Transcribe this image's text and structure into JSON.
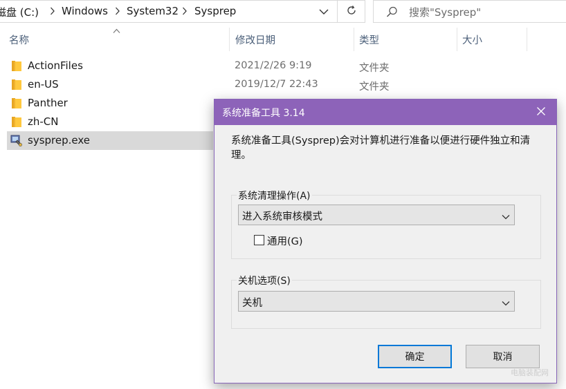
{
  "address": {
    "crumbs": [
      "本地磁盘 (C:)",
      "Windows",
      "System32",
      "Sysprep"
    ],
    "visible_first": "磁盘 (C:)",
    "search_placeholder": "搜索\"Sysprep\""
  },
  "columns": {
    "name": "名称",
    "date": "修改日期",
    "type": "类型",
    "size": "大小"
  },
  "files": [
    {
      "name": "ActionFiles",
      "date": "2021/2/26 9:19",
      "type": "文件夹",
      "icon": "folder-icon"
    },
    {
      "name": "en-US",
      "date": "2019/12/7 22:43",
      "type": "文件夹",
      "icon": "folder-icon"
    },
    {
      "name": "Panther",
      "date": "",
      "type": "",
      "icon": "folder-icon"
    },
    {
      "name": "zh-CN",
      "date": "",
      "type": "",
      "icon": "folder-icon"
    },
    {
      "name": "sysprep.exe",
      "date": "",
      "type": "",
      "icon": "sysprep-app-icon"
    }
  ],
  "dialog": {
    "title": "系统准备工具 3.14",
    "description": "系统准备工具(Sysprep)会对计算机进行准备以便进行硬件独立和清理。",
    "cleanup_group_label": "系统清理操作(A)",
    "cleanup_selected": "进入系统审核模式",
    "generalize_label": "通用(G)",
    "generalize_checked": false,
    "shutdown_group_label": "关机选项(S)",
    "shutdown_selected": "关机",
    "ok_label": "确定",
    "cancel_label": "取消"
  },
  "colors": {
    "titlebar": "#8d63b9",
    "selection": "#d9d9d9",
    "primary_border": "#0078d7"
  },
  "watermark": "电脑装配网"
}
